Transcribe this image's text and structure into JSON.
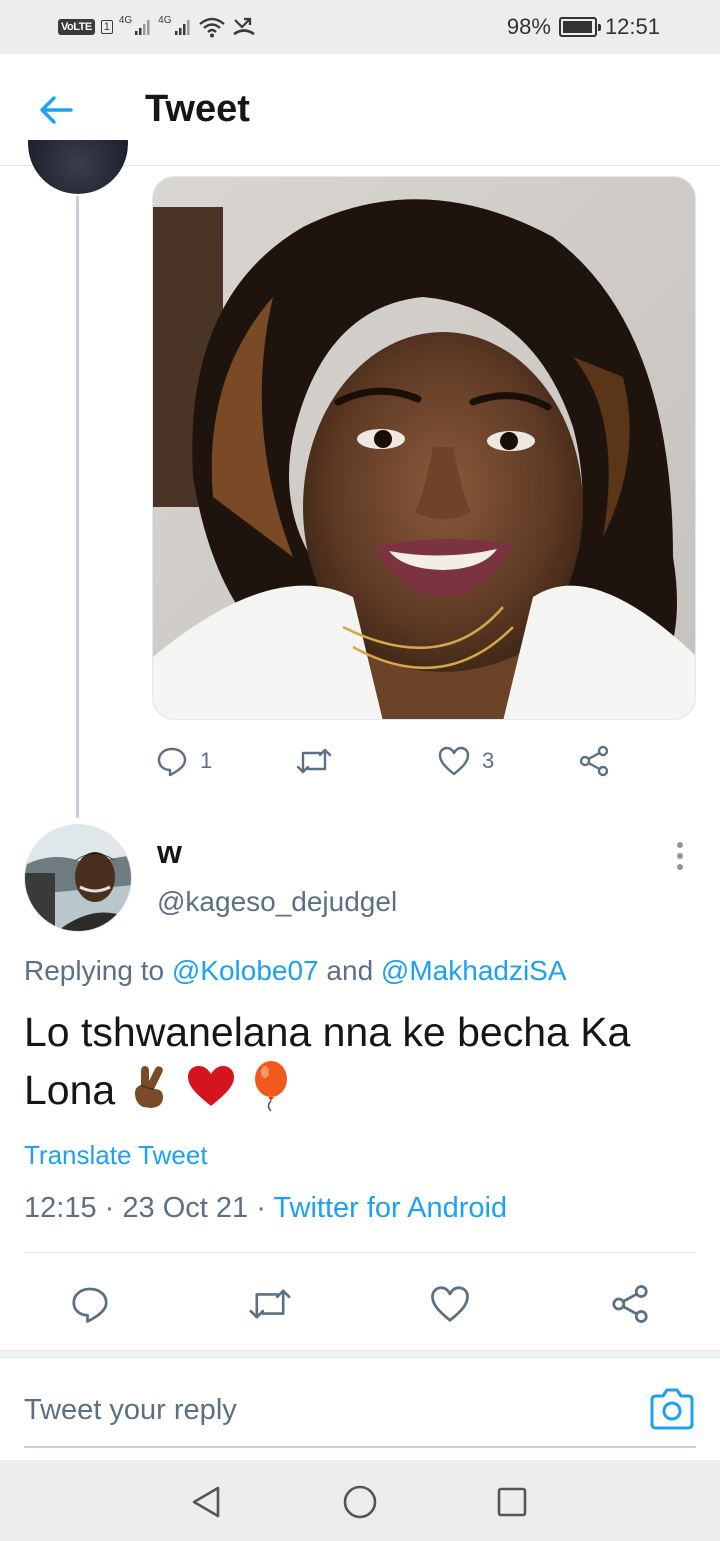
{
  "status_bar": {
    "volte": "VoLTE",
    "sim": "1",
    "net1": "4G",
    "net2": "4G",
    "battery": "98%",
    "battery_level": 0.98,
    "time": "12:51"
  },
  "header": {
    "back_icon": "arrow-left-icon",
    "title": "Tweet"
  },
  "parent_tweet": {
    "image_alt": "Photo of a smiling woman with curly hair in a white shirt",
    "actions": {
      "reply_count": "1",
      "retweet_count": "",
      "like_count": "3"
    }
  },
  "main_tweet": {
    "name": "w",
    "handle": "@kageso_dejudgel",
    "replying_prefix": "Replying to ",
    "mention1": "@Kolobe07",
    "replying_and": " and ",
    "mention2": "@MakhadziSA",
    "text": "Lo tshwanelana nna ke becha Ka Lona",
    "emojis": [
      "crossed-fingers-icon",
      "red-heart-icon",
      "balloon-icon"
    ],
    "translate": "Translate Tweet",
    "time": "12:15",
    "date": "23 Oct 21",
    "separator": "·",
    "source": "Twitter for Android"
  },
  "reply_bar": {
    "placeholder": "Tweet your reply"
  },
  "colors": {
    "accent": "#1da1f2",
    "text_secondary": "#5b7083",
    "heart": "#d6141e",
    "balloon": "#f25a1d"
  }
}
